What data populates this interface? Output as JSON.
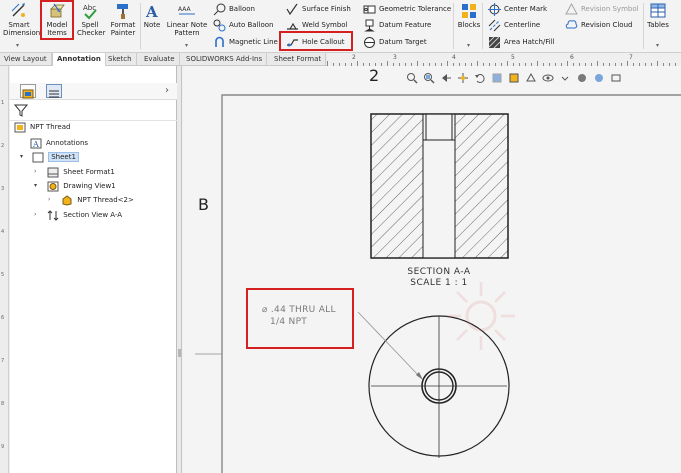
{
  "ribbon": {
    "large": {
      "smart_dimension": "Smart Dimension",
      "model_items": "Model Items",
      "spell_checker": "Spell Checker",
      "format_painter": "Format Painter",
      "note": "Note",
      "linear_note_pattern": "Linear Note Pattern",
      "blocks": "Blocks",
      "tables": "Tables"
    },
    "small": {
      "balloon": "Balloon",
      "auto_balloon": "Auto Balloon",
      "magnetic_line": "Magnetic Line",
      "surface_finish": "Surface Finish",
      "weld_symbol": "Weld Symbol",
      "hole_callout": "Hole Callout",
      "geometric_tolerance": "Geometric Tolerance",
      "datum_feature": "Datum Feature",
      "datum_target": "Datum Target",
      "center_mark": "Center Mark",
      "centerline": "Centerline",
      "area_hatch_fill": "Area Hatch/Fill",
      "revision_symbol": "Revision Symbol",
      "revision_cloud": "Revision Cloud"
    }
  },
  "tabs": [
    "View Layout",
    "Annotation",
    "Sketch",
    "Evaluate",
    "SOLIDWORKS Add-Ins",
    "Sheet Format"
  ],
  "active_tab": "Annotation",
  "ruler": {
    "top_numbers": [
      "2",
      "3",
      "4",
      "5",
      "6",
      "7"
    ],
    "left_numbers": [
      "1",
      "2",
      "3",
      "4",
      "5",
      "6",
      "7",
      "8",
      "9"
    ]
  },
  "tree": {
    "root": "NPT Thread",
    "annotations": "Annotations",
    "sheet": "Sheet1",
    "sheet_format": "Sheet Format1",
    "drawing_view": "Drawing View1",
    "part": "NPT Thread<2>",
    "section_view": "Section View A-A"
  },
  "drawing": {
    "zone_number": "2",
    "zone_letter": "B",
    "section_title": "SECTION A-A",
    "section_scale": "SCALE 1 : 1",
    "callout_line1": "⌀ .44 THRU ALL",
    "callout_line2": "1/4 NPT"
  },
  "colors": {
    "highlight": "#d42020",
    "selection": "#cfe2f7",
    "canvas": "#f4f4f4",
    "callout_text": "#7a7a7a"
  }
}
